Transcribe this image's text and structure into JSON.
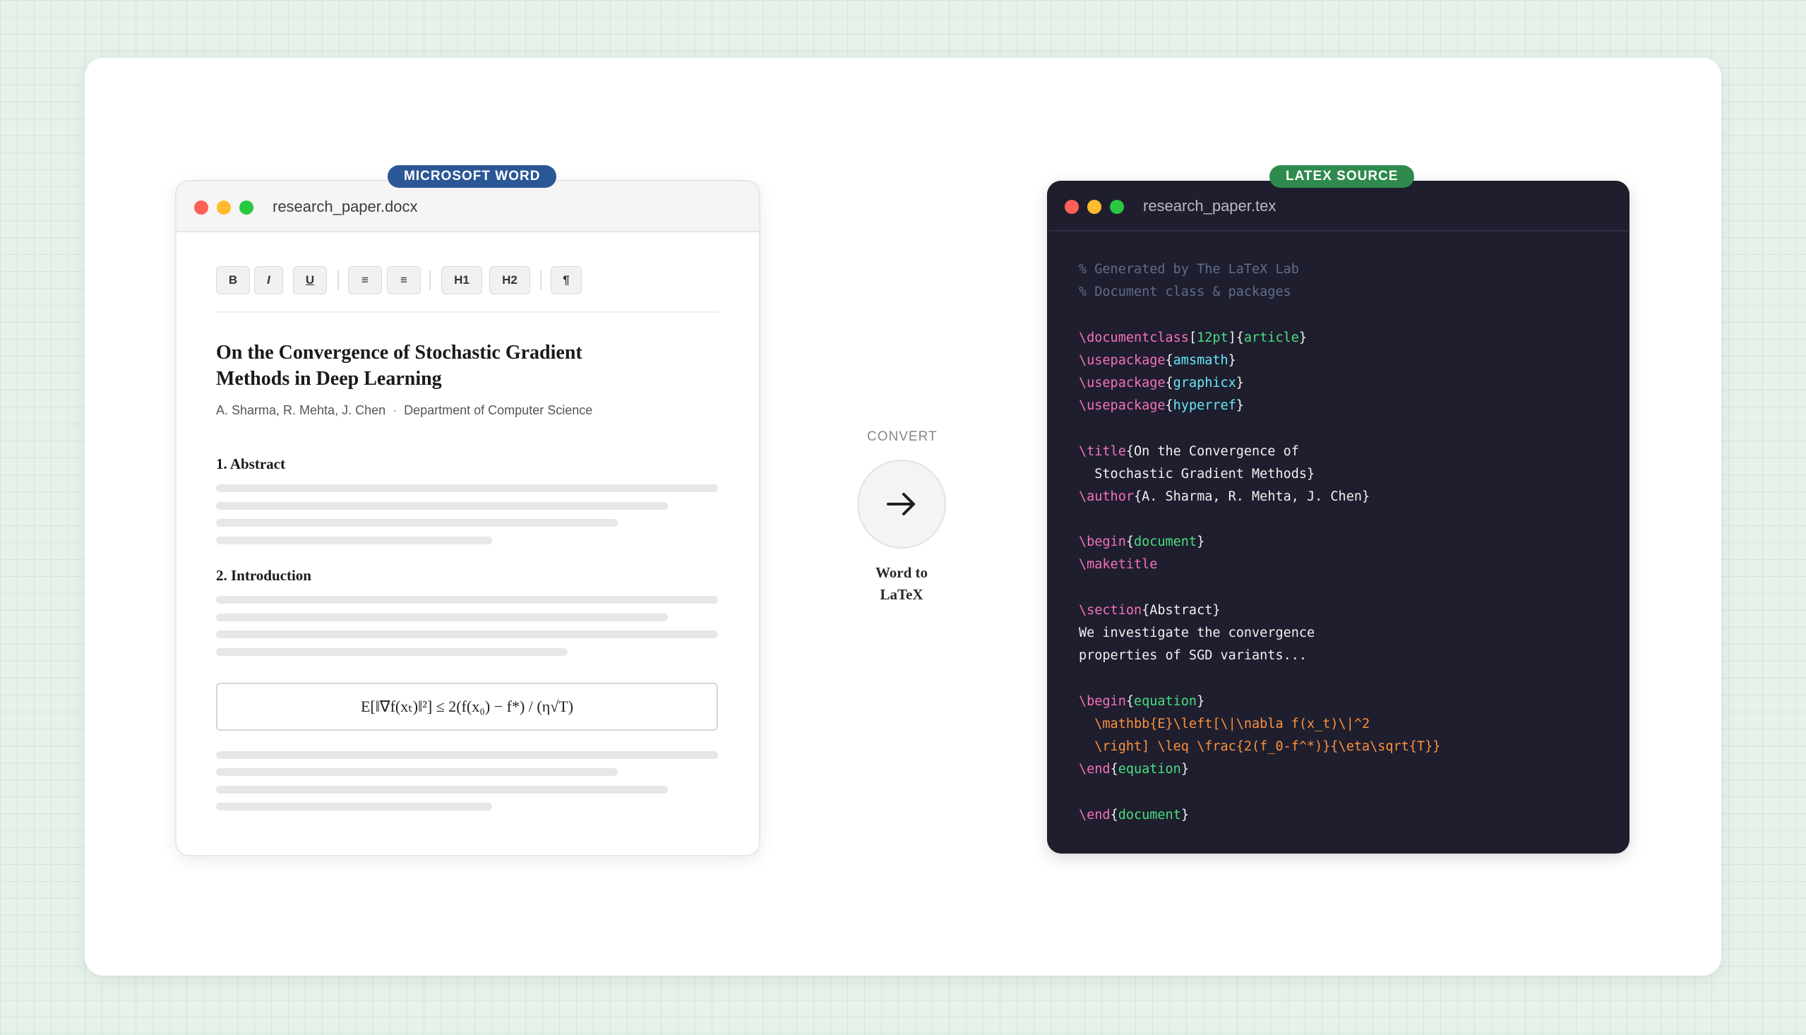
{
  "badges": {
    "word": "MICROSOFT WORD",
    "latex": "LATEX SOURCE"
  },
  "word": {
    "filename": "research_paper.docx",
    "toolbar": [
      {
        "name": "bold-button",
        "label": "B"
      },
      {
        "name": "italic-button",
        "label": "I"
      },
      {
        "name": "underline-button",
        "label": "U"
      },
      {
        "name": "bullet-list-button",
        "label": "≡"
      },
      {
        "name": "numbered-list-button",
        "label": "≡"
      },
      {
        "name": "heading1-button",
        "label": "H1"
      },
      {
        "name": "heading2-button",
        "label": "H2"
      },
      {
        "name": "paragraph-button",
        "label": "¶"
      }
    ],
    "title": "On the Convergence of Stochastic Gradient Methods in Deep Learning",
    "authors": "A. Sharma, R. Mehta, J. Chen",
    "meta_separator": "·",
    "department": "Department of Computer Science",
    "sections": [
      "1. Abstract",
      "2. Introduction"
    ],
    "equation": "E[‖∇f(xₜ)‖²] ≤ 2(f(x₀) − f*) / (η√T)"
  },
  "convert": {
    "label": "CONVERT",
    "caption_line1": "Word to",
    "caption_line2": "LaTeX",
    "icon": "arrow-right-icon"
  },
  "latex": {
    "filename": "research_paper.tex",
    "colors": {
      "comment": "#5f6d8a",
      "command": "#f472b6",
      "arg": "#4ade80",
      "pkg": "#67e8f9",
      "math": "#fb923c",
      "text": "#f0f0f0",
      "brace": "#f0f0f0"
    },
    "lines": [
      [
        [
          "comment",
          "% Generated by The LaTeX Lab"
        ]
      ],
      [
        [
          "comment",
          "% Document class & packages"
        ]
      ],
      [],
      [
        [
          "command",
          "\\documentclass"
        ],
        [
          "brace",
          "["
        ],
        [
          "arg",
          "12pt"
        ],
        [
          "brace",
          "]{"
        ],
        [
          "arg",
          "article"
        ],
        [
          "brace",
          "}"
        ]
      ],
      [
        [
          "command",
          "\\usepackage"
        ],
        [
          "brace",
          "{"
        ],
        [
          "pkg",
          "amsmath"
        ],
        [
          "brace",
          "}"
        ]
      ],
      [
        [
          "command",
          "\\usepackage"
        ],
        [
          "brace",
          "{"
        ],
        [
          "pkg",
          "graphicx"
        ],
        [
          "brace",
          "}"
        ]
      ],
      [
        [
          "command",
          "\\usepackage"
        ],
        [
          "brace",
          "{"
        ],
        [
          "pkg",
          "hyperref"
        ],
        [
          "brace",
          "}"
        ]
      ],
      [],
      [
        [
          "command",
          "\\title"
        ],
        [
          "text",
          "{On the Convergence of"
        ]
      ],
      [
        [
          "text",
          "  Stochastic Gradient Methods}"
        ]
      ],
      [
        [
          "command",
          "\\author"
        ],
        [
          "text",
          "{A. Sharma, R. Mehta, J. Chen}"
        ]
      ],
      [],
      [
        [
          "command",
          "\\begin"
        ],
        [
          "brace",
          "{"
        ],
        [
          "arg",
          "document"
        ],
        [
          "brace",
          "}"
        ]
      ],
      [
        [
          "command",
          "\\maketitle"
        ]
      ],
      [],
      [
        [
          "command",
          "\\section"
        ],
        [
          "text",
          "{Abstract}"
        ]
      ],
      [
        [
          "text",
          "We investigate the convergence"
        ]
      ],
      [
        [
          "text",
          "properties of SGD variants..."
        ]
      ],
      [],
      [
        [
          "command",
          "\\begin"
        ],
        [
          "brace",
          "{"
        ],
        [
          "arg",
          "equation"
        ],
        [
          "brace",
          "}"
        ]
      ],
      [
        [
          "math",
          "  \\mathbb{E}\\left[\\|\\nabla f(x_t)\\|^2"
        ]
      ],
      [
        [
          "math",
          "  \\right] \\leq \\frac{2(f_0-f^*)}{\\eta\\sqrt{T}}"
        ]
      ],
      [
        [
          "command",
          "\\end"
        ],
        [
          "brace",
          "{"
        ],
        [
          "arg",
          "equation"
        ],
        [
          "brace",
          "}"
        ]
      ],
      [],
      [
        [
          "command",
          "\\end"
        ],
        [
          "brace",
          "{"
        ],
        [
          "arg",
          "document"
        ],
        [
          "brace",
          "}"
        ]
      ]
    ]
  }
}
